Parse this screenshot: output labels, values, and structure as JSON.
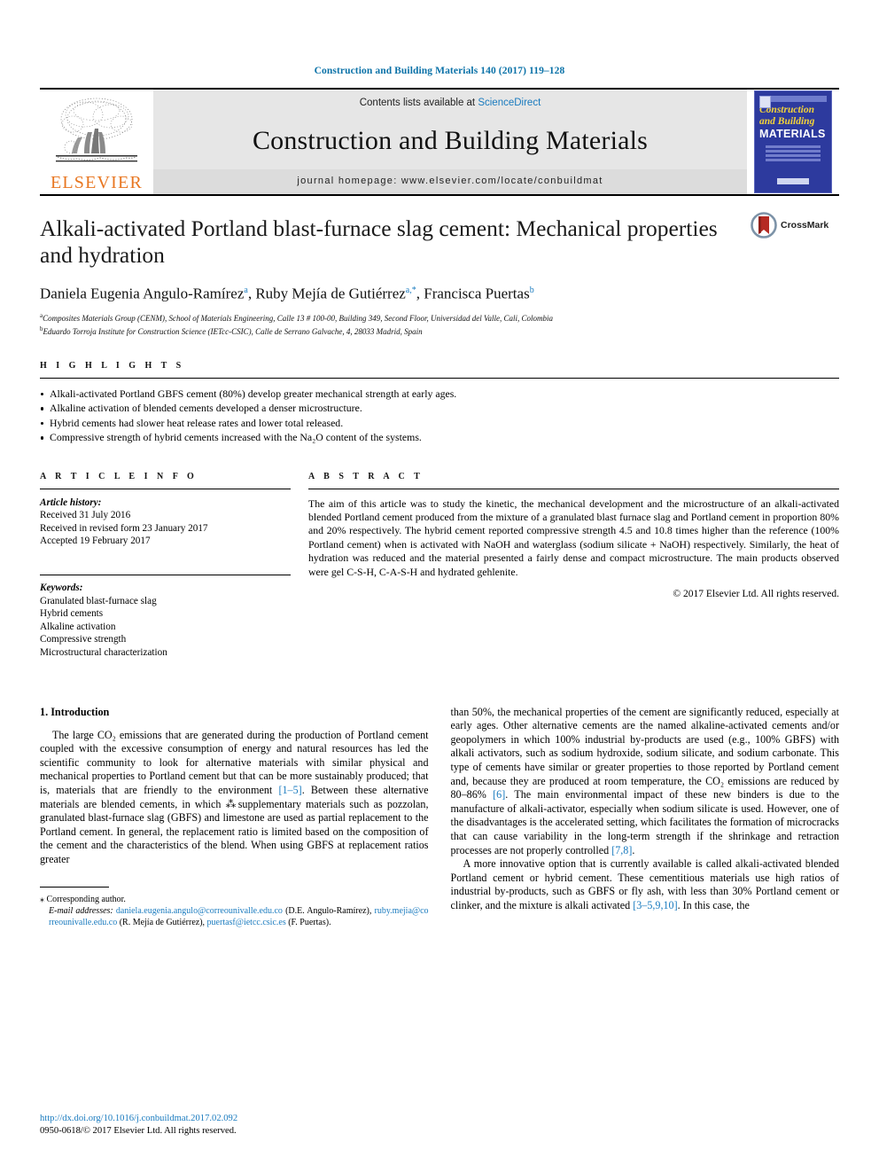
{
  "running_head": "Construction and Building Materials 140 (2017) 119–128",
  "masthead": {
    "publisher_name": "ELSEVIER",
    "contents_prefix": "Contents lists available at ",
    "contents_link": "ScienceDirect",
    "journal_title": "Construction and Building Materials",
    "homepage": "journal homepage: www.elsevier.com/locate/conbuildmat",
    "cover": {
      "line1": "Construction",
      "line2": "and Building",
      "line3": "MATERIALS"
    }
  },
  "article": {
    "title": "Alkali-activated Portland blast-furnace slag cement: Mechanical properties and hydration",
    "authors": [
      {
        "name": "Daniela Eugenia Angulo-Ramírez",
        "marks": "a",
        "sep": ", "
      },
      {
        "name": "Ruby Mejía de Gutiérrez",
        "marks": "a,*",
        "sep": ", "
      },
      {
        "name": "Francisca Puertas",
        "marks": "b",
        "sep": ""
      }
    ],
    "affiliations": [
      {
        "mark": "a",
        "text": "Composites Materials Group (CENM), School of Materials Engineering, Calle 13 # 100-00, Building 349, Second Floor, Universidad del Valle, Cali, Colombia"
      },
      {
        "mark": "b",
        "text": "Eduardo Torroja Institute for Construction Science (IETcc-CSIC), Calle de Serrano Galvache, 4, 28033 Madrid, Spain"
      }
    ],
    "crossmark_label": "CrossMark"
  },
  "highlights": {
    "heading": "H I G H L I G H T S",
    "items": [
      "Alkali-activated Portland GBFS cement (80%) develop greater mechanical strength at early ages.",
      "Alkaline activation of blended cements developed a denser microstructure.",
      "Hybrid cements had slower heat release rates and lower total released.",
      "Compressive strength of hybrid cements increased with the Na₂O content of the systems."
    ]
  },
  "article_info": {
    "heading": "A R T I C L E   I N F O",
    "history_label": "Article history:",
    "history": [
      "Received 31 July 2016",
      "Received in revised form 23 January 2017",
      "Accepted 19 February 2017"
    ],
    "keywords_label": "Keywords:",
    "keywords": [
      "Granulated blast-furnace slag",
      "Hybrid cements",
      "Alkaline activation",
      "Compressive strength",
      "Microstructural characterization"
    ]
  },
  "abstract": {
    "heading": "A B S T R A C T",
    "text": "The aim of this article was to study the kinetic, the mechanical development and the microstructure of an alkali-activated blended Portland cement produced from the mixture of a granulated blast furnace slag and Portland cement in proportion 80% and 20% respectively. The hybrid cement reported compressive strength 4.5 and 10.8 times higher than the reference (100% Portland cement) when is activated with NaOH and waterglass (sodium silicate + NaOH) respectively. Similarly, the heat of hydration was reduced and the material presented a fairly dense and compact microstructure. The main products observed were gel C-S-H, C-A-S-H and hydrated gehlenite.",
    "copyright": "© 2017 Elsevier Ltd. All rights reserved."
  },
  "body": {
    "section_title": "1. Introduction",
    "left_para_1a": "The large CO₂ emissions that are generated during the production of Portland cement coupled with the excessive consumption of energy and natural resources has led the scientific community to look for alternative materials with similar physical and mechanical properties to Portland cement but that can be more sustainably produced; that is, materials that are friendly to the environment ",
    "left_ref_1": "[1–5]",
    "left_para_1b": ". Between these alternative materials are blended cements, in which ⁂supplementary materials such as pozzolan, granulated blast-furnace slag (GBFS) and limestone are used as partial replacement to the Portland cement. In general, the replacement ratio is limited based on the composition of the cement and the characteristics of the blend. When using GBFS at replacement ratios greater",
    "right_para_1": "than 50%, the mechanical properties of the cement are significantly reduced, especially at early ages. Other alternative cements are the named alkaline-activated cements and/or geopolymers in which 100% industrial by-products are used (e.g., 100% GBFS) with alkali activators, such as sodium hydroxide, sodium silicate, and sodium carbonate. This type of cements have similar or greater properties to those reported by Portland cement and, because they are produced at room temperature, the CO₂ emissions are reduced by 80–86% ",
    "right_ref_1": "[6]",
    "right_para_1b": ". The main environmental impact of these new binders is due to the manufacture of alkali-activator, especially when sodium silicate is used. However, one of the disadvantages is the accelerated setting, which facilitates the formation of microcracks that can cause variability in the long-term strength if the shrinkage and retraction processes are not properly controlled ",
    "right_ref_2": "[7,8]",
    "right_para_1c": ".",
    "right_para_2a": "A more innovative option that is currently available is called alkali-activated blended Portland cement or hybrid cement. These cementitious materials use high ratios of industrial by-products, such as GBFS or fly ash, with less than 30% Portland cement or clinker, and the mixture is alkali activated ",
    "right_ref_3": "[3–5,9,10]",
    "right_para_2b": ". In this case, the"
  },
  "footnotes": {
    "corresponding": "⁎ Corresponding author.",
    "email_label": "E-mail addresses:",
    "email_1": "daniela.eugenia.angulo@correounivalle.edu.co",
    "email_1_who": " (D.E. Angulo-Ramírez), ",
    "email_2": "ruby.mejia@correounivalle.edu.co",
    "email_2_who": " (R. Mejía de Gutiérrez), ",
    "email_3": "puertasf@ietcc.csic.es",
    "email_3_who": " (F. Puertas)."
  },
  "footer": {
    "doi": "http://dx.doi.org/10.1016/j.conbuildmat.2017.02.092",
    "issn_line": "0950-0618/© 2017 Elsevier Ltd. All rights reserved."
  },
  "colors": {
    "link_blue": "#1a7bbf",
    "elsevier_orange": "#e87722",
    "cover_blue": "#2d3a9e",
    "cover_yellow": "#f2d23a",
    "crossmark_red": "#b52a23"
  }
}
